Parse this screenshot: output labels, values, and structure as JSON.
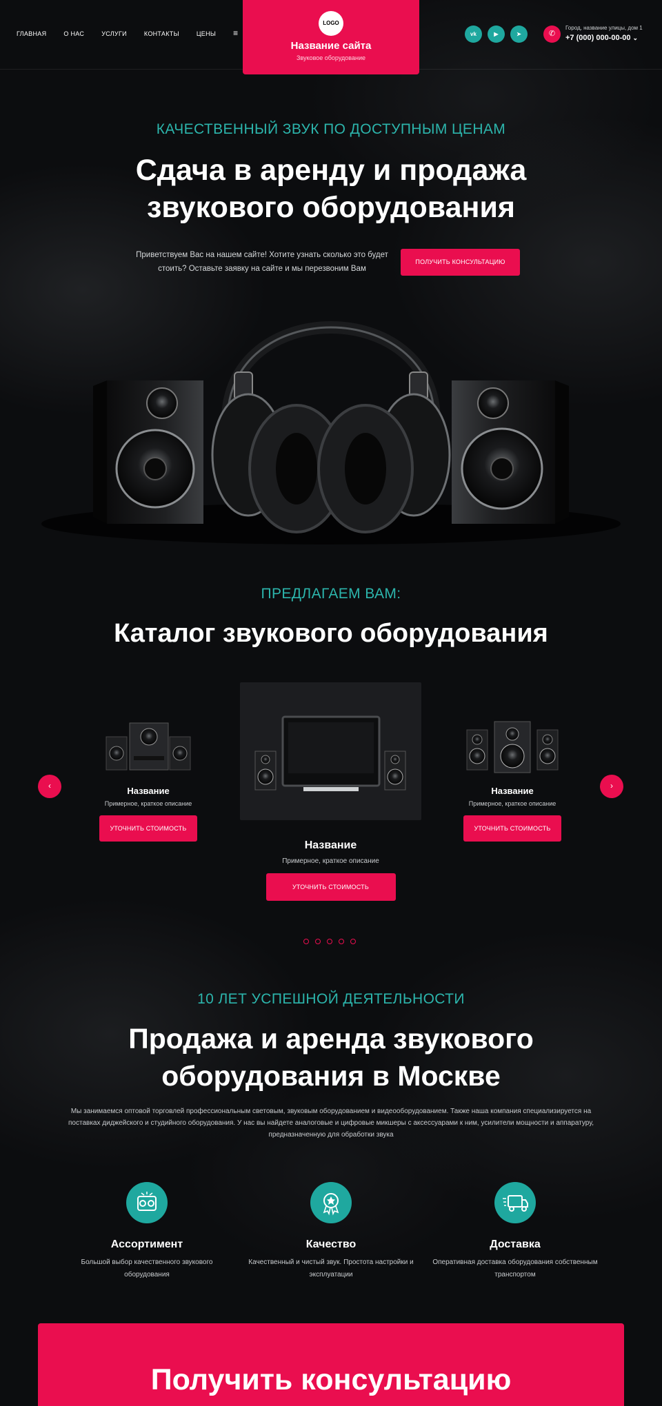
{
  "header": {
    "nav": [
      "ГЛАВНАЯ",
      "О НАС",
      "УСЛУГИ",
      "КОНТАКТЫ",
      "ЦЕНЫ"
    ],
    "menu_icon": "≡",
    "logo_text": "LOGO",
    "site_name": "Название сайта",
    "site_subtitle": "Звуковое оборудование",
    "socials": [
      {
        "icon": "vk-icon",
        "glyph": "vk"
      },
      {
        "icon": "youtube-icon",
        "glyph": "▶"
      },
      {
        "icon": "telegram-icon",
        "glyph": "➤"
      }
    ],
    "address": "Город, название улицы, дом 1",
    "phone": "+7 (000) 000-00-00",
    "phone_chevron": "⌄"
  },
  "hero": {
    "kicker": "КАЧЕСТВЕННЫЙ ЗВУК ПО ДОСТУПНЫМ ЦЕНАМ",
    "title_line1": "Сдача в аренду и продажа",
    "title_line2": "звукового оборудования",
    "text": "Приветствуем Вас на нашем сайте! Хотите узнать сколько это будет стоить? Оставьте заявку на сайте и мы перезвоним Вам",
    "button": "ПОЛУЧИТЬ КОНСУЛЬТАЦИЮ"
  },
  "catalog": {
    "kicker": "ПРЕДЛАГАЕМ ВАМ:",
    "title": "Каталог звукового оборудования",
    "items": [
      {
        "title": "Название",
        "desc": "Примерное, краткое описание",
        "button": "УТОЧНИТЬ СТОИМОСТЬ"
      },
      {
        "title": "Название",
        "desc": "Примерное, краткое описание",
        "button": "УТОЧНИТЬ СТОИМОСТЬ"
      },
      {
        "title": "Название",
        "desc": "Примерное, краткое описание",
        "button": "УТОЧНИТЬ СТОИМОСТЬ"
      }
    ],
    "prev_arrow": "‹",
    "next_arrow": "›",
    "dot_count": 5
  },
  "about": {
    "kicker": "10 ЛЕТ УСПЕШНОЙ ДЕЯТЕЛЬНОСТИ",
    "title_line1": "Продажа и аренда звукового",
    "title_line2": "оборудования в Москве",
    "text": "Мы занимаемся оптовой торговлей профессиональным световым, звуковым оборудованием и видеооборудованием. Также наша компания специализируется на поставках диджейского и студийного оборудования. У нас вы найдете аналоговые и цифровые микшеры с аксессуарами к ним, усилители мощности и аппаратуру, предназначенную для обработки звука",
    "features": [
      {
        "icon": "speakers-icon",
        "title": "Ассортимент",
        "desc": "Большой выбор качественного звукового оборудования"
      },
      {
        "icon": "quality-medal-icon",
        "title": "Качество",
        "desc": "Качественный и чистый звук. Простота настройки и эксплуатации"
      },
      {
        "icon": "delivery-truck-icon",
        "title": "Доставка",
        "desc": "Оперативная доставка оборудования собственным транспортом"
      }
    ]
  },
  "cta": {
    "title": "Получить консультацию"
  },
  "colors": {
    "accent": "#ea0e4f",
    "teal": "#1fa89f",
    "background": "#0c0d0f"
  }
}
